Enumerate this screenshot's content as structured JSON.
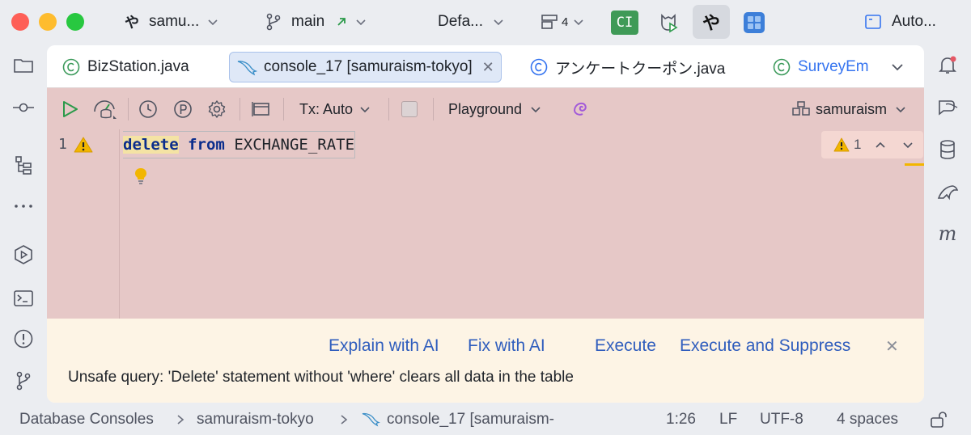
{
  "titlebar": {
    "project": "samu...",
    "branch": "main",
    "run_config": "Defa...",
    "windows_count": "4",
    "ci_label": "CI",
    "ya_label": "や",
    "autofill": "Auto..."
  },
  "tabs": [
    {
      "label": "BizStation.java",
      "icon": "java-class-icon"
    },
    {
      "label": "console_17 [samuraism-tokyo]",
      "icon": "mysql-dolphin-icon",
      "active": true
    },
    {
      "label": "アンケートクーポン.java",
      "icon": "java-class-icon"
    },
    {
      "label": "SurveyEm",
      "icon": "java-class-icon"
    }
  ],
  "toolbar": {
    "tx_label": "Tx: Auto",
    "playground_label": "Playground",
    "datasource_label": "samuraism"
  },
  "editor": {
    "line_number": "1",
    "code": {
      "kw1": "delete",
      "kw2": "from",
      "table": "EXCHANGE_RATE"
    },
    "warning_count": "1"
  },
  "notice": {
    "explain_ai": "Explain with AI",
    "fix_ai": "Fix with AI",
    "execute": "Execute",
    "execute_suppress": "Execute and Suppress",
    "message": "Unsafe query: 'Delete' statement without 'where' clears all data in the table"
  },
  "statusbar": {
    "breadcrumb_1": "Database Consoles",
    "breadcrumb_2": "samuraism-tokyo",
    "breadcrumb_3": "console_17 [samuraism-",
    "position": "1:26",
    "line_sep": "LF",
    "encoding": "UTF-8",
    "indent": "4 spaces"
  },
  "colors": {
    "accent": "#2f5dbd",
    "editor_bg": "#e6c8c7",
    "notice_bg": "#fdf4e5",
    "warning": "#f2b600"
  }
}
